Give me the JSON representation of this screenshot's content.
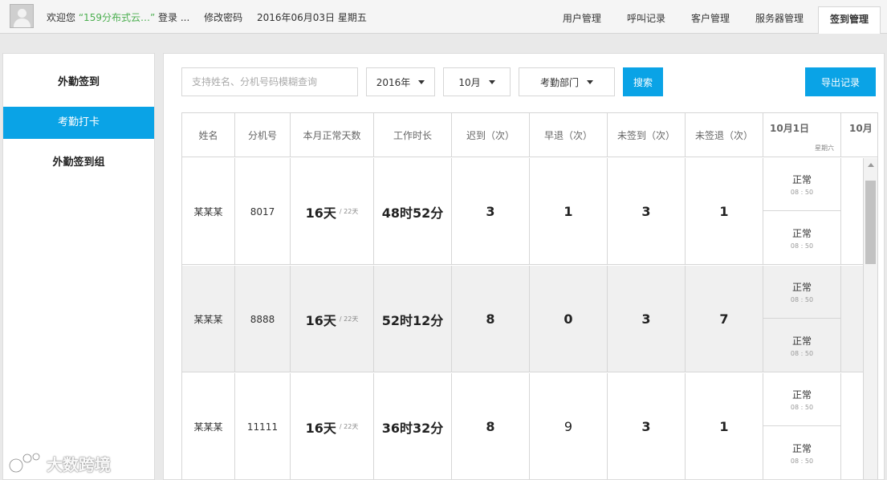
{
  "topbar": {
    "welcome_prefix": "欢迎您",
    "user_name": "“159分布式云…”",
    "login_suffix": "登录 ...",
    "change_password": "修改密码",
    "date_text": "2016年06月03日 星期五",
    "nav": [
      {
        "label": "用户管理"
      },
      {
        "label": "呼叫记录"
      },
      {
        "label": "客户管理"
      },
      {
        "label": "服务器管理"
      },
      {
        "label": "签到管理"
      }
    ]
  },
  "sidebar": {
    "items": [
      {
        "label": "外勤签到"
      },
      {
        "label": "考勤打卡"
      },
      {
        "label": "外勤签到组"
      }
    ]
  },
  "toolbar": {
    "search_placeholder": "支持姓名、分机号码模糊查询",
    "year": "2016年",
    "month": "10月",
    "department": "考勤部门",
    "search_label": "搜索",
    "export_label": "导出记录"
  },
  "table": {
    "headers": {
      "name": "姓名",
      "ext": "分机号",
      "normal_days": "本月正常天数",
      "work_hours": "工作时长",
      "late": "迟到（次）",
      "early": "早退（次）",
      "no_checkin": "未签到（次）",
      "no_checkout": "未签退（次）",
      "date1": "10月1日",
      "date1_weekday": "星期六",
      "date2": "10月"
    },
    "rows": [
      {
        "name": "某某某",
        "ext": "8017",
        "normal_days": "16天",
        "total_days": "/ 22天",
        "work_hours": "48时52分",
        "late": "3",
        "early": "1",
        "no_checkin": "3",
        "no_checkout": "1",
        "day1": [
          {
            "status": "正常",
            "time": "08 : 50"
          },
          {
            "status": "正常",
            "time": "08 : 50"
          }
        ]
      },
      {
        "name": "某某某",
        "ext": "8888",
        "normal_days": "16天",
        "total_days": "/ 22天",
        "work_hours": "52时12分",
        "late": "8",
        "early": "0",
        "no_checkin": "3",
        "no_checkout": "7",
        "day1": [
          {
            "status": "正常",
            "time": "08 : 50"
          },
          {
            "status": "正常",
            "time": "08 : 50"
          }
        ]
      },
      {
        "name": "某某某",
        "ext": "11111",
        "normal_days": "16天",
        "total_days": "/ 22天",
        "work_hours": "36时32分",
        "late": "8",
        "early": "9",
        "no_checkin": "3",
        "no_checkout": "1",
        "day1": [
          {
            "status": "正常",
            "time": "08 : 50"
          },
          {
            "status": "正常",
            "time": "08 : 50"
          }
        ]
      }
    ]
  },
  "watermark": {
    "text": "大数跨境"
  },
  "colors": {
    "accent": "#0aa3e6",
    "username": "#4caf50"
  }
}
